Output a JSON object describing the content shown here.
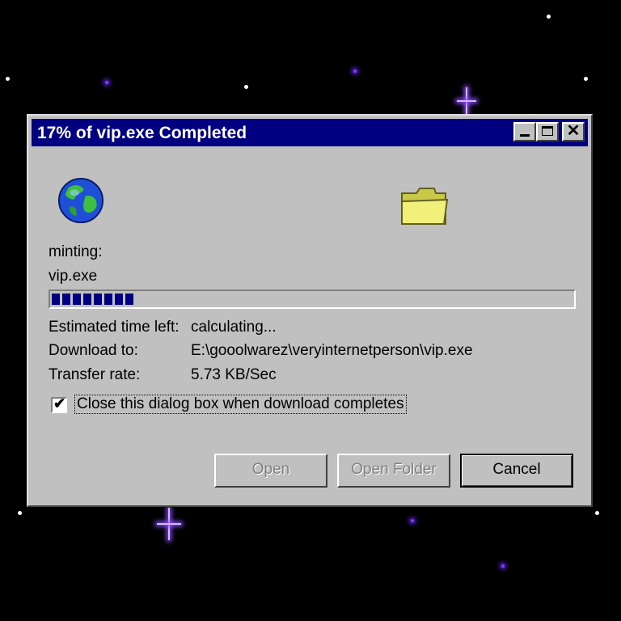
{
  "window": {
    "title": "17% of vip.exe Completed",
    "minimize_icon": "minimize-icon",
    "maximize_icon": "maximize-icon",
    "close_icon": "close-icon",
    "close_glyph": "✕"
  },
  "status": {
    "action": "minting:",
    "file": "vip.exe",
    "progress_percent": 17
  },
  "details": {
    "estimated_label": "Estimated time left:",
    "estimated_value": "calculating...",
    "download_to_label": "Download to:",
    "download_to_value": "E:\\gooolwarez\\veryinternetperson\\vip.exe",
    "transfer_rate_label": "Transfer rate:",
    "transfer_rate_value": "5.73 KB/Sec"
  },
  "close_on_complete": {
    "label": "Close this dialog box when download completes",
    "checked": true,
    "check_glyph": "✔"
  },
  "buttons": {
    "open_label": "Open",
    "open_folder_label": "Open Folder",
    "cancel_label": "Cancel"
  },
  "colors": {
    "titlebar": "#000080",
    "dialog": "#c0c0c0",
    "progress": "#000080",
    "background": "#000000"
  },
  "icons": {
    "globe": "globe-icon",
    "folder": "folder-icon"
  }
}
